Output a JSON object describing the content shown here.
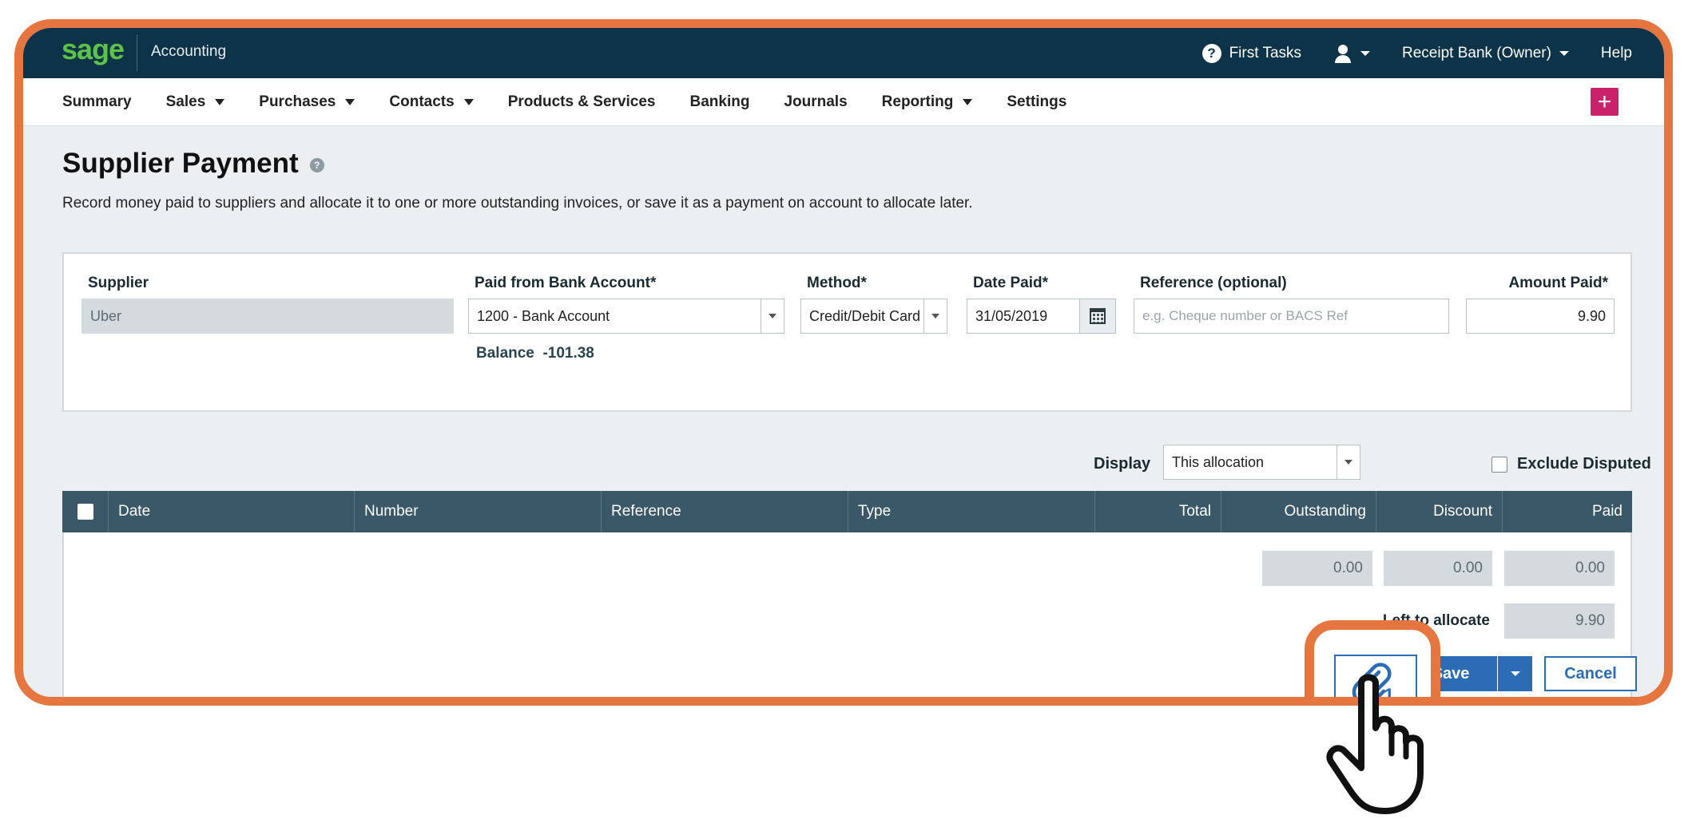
{
  "topbar": {
    "logo": "sage",
    "app_name": "Accounting",
    "first_tasks": "First Tasks",
    "account": "Receipt Bank (Owner)",
    "help": "Help"
  },
  "nav": {
    "items": [
      {
        "label": "Summary",
        "dropdown": false
      },
      {
        "label": "Sales",
        "dropdown": true
      },
      {
        "label": "Purchases",
        "dropdown": true
      },
      {
        "label": "Contacts",
        "dropdown": true
      },
      {
        "label": "Products & Services",
        "dropdown": false
      },
      {
        "label": "Banking",
        "dropdown": false
      },
      {
        "label": "Journals",
        "dropdown": false
      },
      {
        "label": "Reporting",
        "dropdown": true
      },
      {
        "label": "Settings",
        "dropdown": false
      }
    ],
    "plus": "+"
  },
  "page": {
    "title": "Supplier Payment",
    "description": "Record money paid to suppliers and allocate it to one or more outstanding invoices, or save it as a payment on account to allocate later."
  },
  "form": {
    "supplier_label": "Supplier",
    "supplier_value": "Uber",
    "bank_label": "Paid from Bank Account*",
    "bank_value": "1200 - Bank Account",
    "balance_label": "Balance",
    "balance_value": "-101.38",
    "method_label": "Method*",
    "method_value": "Credit/Debit Card",
    "date_label": "Date Paid*",
    "date_value": "31/05/2019",
    "reference_label": "Reference (optional)",
    "reference_placeholder": "e.g. Cheque number or BACS Ref",
    "amount_label": "Amount Paid*",
    "amount_value": "9.90"
  },
  "filter": {
    "display_label": "Display",
    "display_value": "This allocation",
    "exclude_label": "Exclude Disputed"
  },
  "table": {
    "columns": [
      "Date",
      "Number",
      "Reference",
      "Type",
      "Total",
      "Outstanding",
      "Discount",
      "Paid"
    ],
    "totals": {
      "outstanding": "0.00",
      "discount": "0.00",
      "paid": "0.00"
    },
    "left_to_allocate_label": "Left to allocate",
    "left_to_allocate_value": "9.90"
  },
  "actions": {
    "attachment_count": "1",
    "save": "Save",
    "cancel": "Cancel"
  },
  "colors": {
    "highlight": "#e6763f",
    "topbar": "#0c3347",
    "primary": "#2b6cb4",
    "table_header": "#3a5868",
    "plus_button": "#c8236a"
  }
}
